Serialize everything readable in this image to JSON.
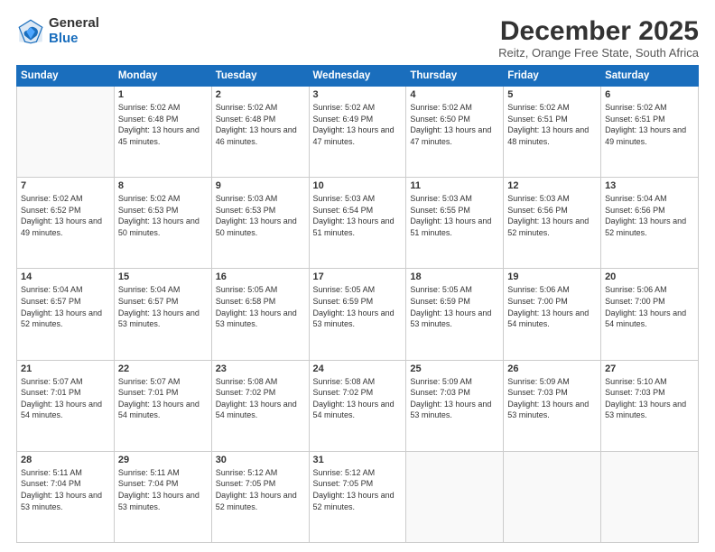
{
  "logo": {
    "general": "General",
    "blue": "Blue"
  },
  "title": "December 2025",
  "subtitle": "Reitz, Orange Free State, South Africa",
  "headers": [
    "Sunday",
    "Monday",
    "Tuesday",
    "Wednesday",
    "Thursday",
    "Friday",
    "Saturday"
  ],
  "weeks": [
    [
      {
        "day": "",
        "empty": true
      },
      {
        "day": "1",
        "rise": "5:02 AM",
        "set": "6:48 PM",
        "daylight": "13 hours and 45 minutes."
      },
      {
        "day": "2",
        "rise": "5:02 AM",
        "set": "6:48 PM",
        "daylight": "13 hours and 46 minutes."
      },
      {
        "day": "3",
        "rise": "5:02 AM",
        "set": "6:49 PM",
        "daylight": "13 hours and 47 minutes."
      },
      {
        "day": "4",
        "rise": "5:02 AM",
        "set": "6:50 PM",
        "daylight": "13 hours and 47 minutes."
      },
      {
        "day": "5",
        "rise": "5:02 AM",
        "set": "6:51 PM",
        "daylight": "13 hours and 48 minutes."
      },
      {
        "day": "6",
        "rise": "5:02 AM",
        "set": "6:51 PM",
        "daylight": "13 hours and 49 minutes."
      }
    ],
    [
      {
        "day": "7",
        "rise": "5:02 AM",
        "set": "6:52 PM",
        "daylight": "13 hours and 49 minutes."
      },
      {
        "day": "8",
        "rise": "5:02 AM",
        "set": "6:53 PM",
        "daylight": "13 hours and 50 minutes."
      },
      {
        "day": "9",
        "rise": "5:03 AM",
        "set": "6:53 PM",
        "daylight": "13 hours and 50 minutes."
      },
      {
        "day": "10",
        "rise": "5:03 AM",
        "set": "6:54 PM",
        "daylight": "13 hours and 51 minutes."
      },
      {
        "day": "11",
        "rise": "5:03 AM",
        "set": "6:55 PM",
        "daylight": "13 hours and 51 minutes."
      },
      {
        "day": "12",
        "rise": "5:03 AM",
        "set": "6:56 PM",
        "daylight": "13 hours and 52 minutes."
      },
      {
        "day": "13",
        "rise": "5:04 AM",
        "set": "6:56 PM",
        "daylight": "13 hours and 52 minutes."
      }
    ],
    [
      {
        "day": "14",
        "rise": "5:04 AM",
        "set": "6:57 PM",
        "daylight": "13 hours and 52 minutes."
      },
      {
        "day": "15",
        "rise": "5:04 AM",
        "set": "6:57 PM",
        "daylight": "13 hours and 53 minutes."
      },
      {
        "day": "16",
        "rise": "5:05 AM",
        "set": "6:58 PM",
        "daylight": "13 hours and 53 minutes."
      },
      {
        "day": "17",
        "rise": "5:05 AM",
        "set": "6:59 PM",
        "daylight": "13 hours and 53 minutes."
      },
      {
        "day": "18",
        "rise": "5:05 AM",
        "set": "6:59 PM",
        "daylight": "13 hours and 53 minutes."
      },
      {
        "day": "19",
        "rise": "5:06 AM",
        "set": "7:00 PM",
        "daylight": "13 hours and 54 minutes."
      },
      {
        "day": "20",
        "rise": "5:06 AM",
        "set": "7:00 PM",
        "daylight": "13 hours and 54 minutes."
      }
    ],
    [
      {
        "day": "21",
        "rise": "5:07 AM",
        "set": "7:01 PM",
        "daylight": "13 hours and 54 minutes."
      },
      {
        "day": "22",
        "rise": "5:07 AM",
        "set": "7:01 PM",
        "daylight": "13 hours and 54 minutes."
      },
      {
        "day": "23",
        "rise": "5:08 AM",
        "set": "7:02 PM",
        "daylight": "13 hours and 54 minutes."
      },
      {
        "day": "24",
        "rise": "5:08 AM",
        "set": "7:02 PM",
        "daylight": "13 hours and 54 minutes."
      },
      {
        "day": "25",
        "rise": "5:09 AM",
        "set": "7:03 PM",
        "daylight": "13 hours and 53 minutes."
      },
      {
        "day": "26",
        "rise": "5:09 AM",
        "set": "7:03 PM",
        "daylight": "13 hours and 53 minutes."
      },
      {
        "day": "27",
        "rise": "5:10 AM",
        "set": "7:03 PM",
        "daylight": "13 hours and 53 minutes."
      }
    ],
    [
      {
        "day": "28",
        "rise": "5:11 AM",
        "set": "7:04 PM",
        "daylight": "13 hours and 53 minutes."
      },
      {
        "day": "29",
        "rise": "5:11 AM",
        "set": "7:04 PM",
        "daylight": "13 hours and 53 minutes."
      },
      {
        "day": "30",
        "rise": "5:12 AM",
        "set": "7:05 PM",
        "daylight": "13 hours and 52 minutes."
      },
      {
        "day": "31",
        "rise": "5:12 AM",
        "set": "7:05 PM",
        "daylight": "13 hours and 52 minutes."
      },
      {
        "day": "",
        "empty": true
      },
      {
        "day": "",
        "empty": true
      },
      {
        "day": "",
        "empty": true
      }
    ]
  ]
}
